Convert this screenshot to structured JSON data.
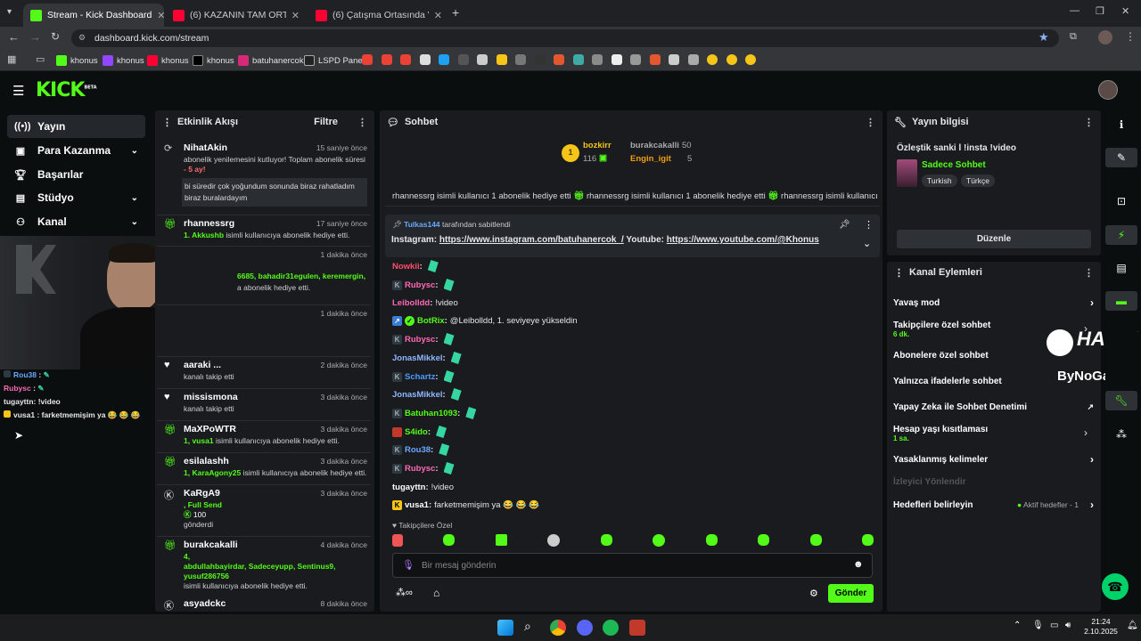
{
  "browser": {
    "tabs": [
      {
        "title": "Stream - Kick Dashboard",
        "color": "#53fc18"
      },
      {
        "title": "(6) KAZANIN TAM ORTASINDA",
        "color": "#ff0033"
      },
      {
        "title": "(6) Çatışma Ortasında Vurulan",
        "color": "#ff0033"
      }
    ],
    "url": "dashboard.kick.com/stream",
    "bookmarks": [
      "khonus",
      "khonus",
      "khonus",
      "khonus",
      "batuhanercok",
      "LSPD Panel"
    ]
  },
  "app": {
    "logo": "KICK",
    "logo_sup": "BETA"
  },
  "sidebar": {
    "items": [
      {
        "label": "Yayın",
        "icon": "broadcast-icon",
        "active": true
      },
      {
        "label": "Para Kazanma",
        "icon": "wallet-icon",
        "chevron": true
      },
      {
        "label": "Başarılar",
        "icon": "trophy-icon"
      },
      {
        "label": "Stüdyo",
        "icon": "studio-icon",
        "chevron": true
      },
      {
        "label": "Kanal",
        "icon": "channel-icon",
        "chevron": true
      }
    ]
  },
  "overlay_chat": [
    {
      "user": "Rou38",
      "text": ":",
      "color": "#6aa8ff"
    },
    {
      "user": "Rubysc",
      "text": ":",
      "color": "#ff69b4"
    },
    {
      "user": "tugayttn",
      "text": ": !video",
      "color": "#ffffff"
    },
    {
      "user": "vusa1",
      "text": ": farketmemişim ya 😂 😂 😂",
      "color": "#ffffff"
    }
  ],
  "activity": {
    "title": "Etkinlik Akışı",
    "filter": "Filtre",
    "events": [
      {
        "name": "NihatAkin",
        "time": "15 saniye önce",
        "text": "abonelik yenilemesini kutluyor! Toplam abonelik süresi",
        "extra": "- 5 ay!",
        "note": "bi süredir çok yoğundum sonunda biraz rahatladım biraz buralardayım"
      },
      {
        "name": "rhannessrg",
        "time": "17 saniye önce",
        "gift_from": "1. Akkushb",
        "text": "isimli kullanıcıya abonelik hediye etti."
      },
      {
        "time": "1 dakika önce",
        "names": "6685, bahadir31egulen, keremergin,",
        "text": "a abonelik hediye etti."
      },
      {
        "time": "1 dakika önce"
      },
      {
        "name": "aaraki ...",
        "time": "2 dakika önce",
        "text": "kanalı takip etti"
      },
      {
        "name": "missismona",
        "time": "3 dakika önce",
        "text": "kanalı takip etti"
      },
      {
        "name": "MaXPoWTR",
        "time": "3 dakika önce",
        "gift_from": "1, vusa1",
        "text": "isimli kullanıcıya abonelik hediye etti."
      },
      {
        "name": "esilalashh",
        "time": "3 dakika önce",
        "gift_from": "1, KaraAgony25",
        "text": "isimli kullanıcıya abonelik hediye etti."
      },
      {
        "name": "KaRgA9",
        "time": "3 dakika önce",
        "kicks_text": ", Full Send",
        "kicks": "100",
        "text": "gönderdi"
      },
      {
        "name": "burakcakalli",
        "time": "4 dakika önce",
        "gift_from": "4,",
        "gift_list": "abdullahbayirdar, Sadeceyupp, Sentinus9, yusuf286756",
        "text": "isimli kullanıcıya abonelik hediye etti."
      },
      {
        "name": "asyadckc",
        "time": "8 dakika önce"
      }
    ]
  },
  "chat": {
    "title": "Sohbet",
    "leaderboard": [
      {
        "rank": "1",
        "name": "bozkirr",
        "value": "116"
      },
      {
        "name": "burakcakalli",
        "value": "50"
      },
      {
        "name": "Engin_igit",
        "value": "5"
      }
    ],
    "ticker": "rhannessrg isimli kullanıcı 1 abonelik hediye etti",
    "pinned_by": "Tulkas144",
    "pinned_suffix": "tarafından sabitlendi",
    "pinned_text_prefix": "Instagram:",
    "pinned_link1": "https://www.instagram.com/batuhanercok_/",
    "pinned_mid": "Youtube:",
    "pinned_link2": "https://www.youtube.com/@Khonus",
    "messages": [
      {
        "user": "Nowkii",
        "color": "#ff4d6d",
        "text": "",
        "emote": true
      },
      {
        "user": "Rubysc",
        "color": "#ff69b4",
        "text": "",
        "emote": true
      },
      {
        "user": "Leibolldd",
        "color": "#ff69b4",
        "text": "!video",
        "emote": false
      },
      {
        "user": "BotRix",
        "color": "#53fc18",
        "text": "@Leibolldd, 1. seviyeye yükseldin",
        "emote": false
      },
      {
        "user": "Rubysc",
        "color": "#ff69b4",
        "text": "",
        "emote": true
      },
      {
        "user": "JonasMikkel",
        "color": "#8fb7ff",
        "text": "",
        "emote": true
      },
      {
        "user": "Schartz",
        "color": "#4e9bff",
        "text": "",
        "emote": true
      },
      {
        "user": "JonasMikkel",
        "color": "#8fb7ff",
        "text": "",
        "emote": true
      },
      {
        "user": "Batuhan1093",
        "color": "#53fc18",
        "text": "",
        "emote": true
      },
      {
        "user": "S4ido",
        "color": "#53fc18",
        "text": "",
        "emote": true
      },
      {
        "user": "Rou38",
        "color": "#6aa8ff",
        "text": "",
        "emote": true
      },
      {
        "user": "Rubysc",
        "color": "#ff69b4",
        "text": "",
        "emote": true
      },
      {
        "user": "tugayttn",
        "color": "#ffffff",
        "text": "!video",
        "emote": false
      },
      {
        "user": "vusa1",
        "color": "#ffffff",
        "text": "farketmemişim ya 😂 😂 😂",
        "emote": false
      }
    ],
    "followers_only": "Takipçilere Özel",
    "input_placeholder": "Bir mesaj gönderin",
    "send": "Gönder"
  },
  "stream_info": {
    "title": "Yayın bilgisi",
    "stream_title": "Özleştik sanki l !insta !video",
    "category": "Sadece Sohbet",
    "tags": [
      "Turkish",
      "Türkçe"
    ],
    "edit": "Düzenle"
  },
  "channel_actions": {
    "title": "Kanal Eylemleri",
    "items": [
      {
        "label": "Yavaş mod",
        "sub": "",
        "chevron": true
      },
      {
        "label": "Takipçilere özel sohbet",
        "sub": "6 dk.",
        "chevron": true
      },
      {
        "label": "Abonelere özel sohbet",
        "sub": "",
        "chevron": false
      },
      {
        "label": "Yalnızca ifadelerle sohbet",
        "sub": "",
        "chevron": false
      },
      {
        "label": "Yapay Zeka ile Sohbet Denetimi",
        "sub": "",
        "chevron": false
      },
      {
        "label": "Hesap yaşı kısıtlaması",
        "sub": "1 sa.",
        "chevron": true
      },
      {
        "label": "Yasaklanmış kelimeler",
        "sub": "",
        "chevron": true
      },
      {
        "label": "İzleyici Yönlendir",
        "sub": "",
        "chevron": false
      },
      {
        "label": "Hedefleri belirleyin",
        "sub": "",
        "chevron": true,
        "status": "Aktif hedefler - 1"
      }
    ]
  },
  "watermark": {
    "line1": "HAWK",
    "line2": "ByNoGame"
  },
  "taskbar": {
    "time": "21:24",
    "date": "2.10.2025"
  }
}
